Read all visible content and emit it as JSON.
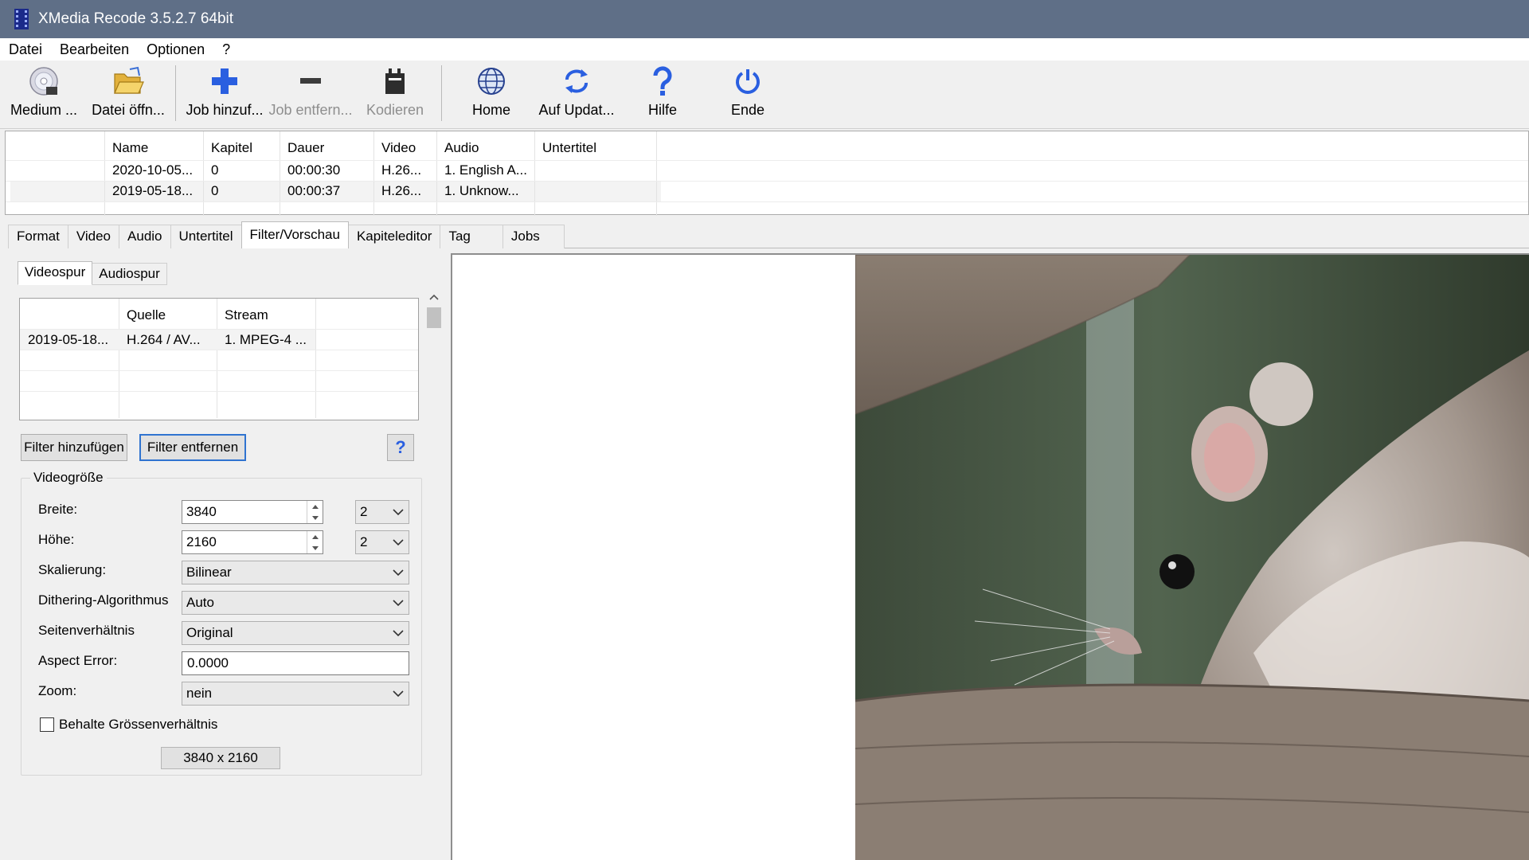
{
  "window": {
    "title": "XMedia Recode 3.5.2.7 64bit"
  },
  "menu": [
    "Datei",
    "Bearbeiten",
    "Optionen",
    "?"
  ],
  "toolbar": {
    "medium": "Medium ...",
    "open_file": "Datei öffn...",
    "add_job": "Job hinzuf...",
    "remove_job": "Job entfern...",
    "encode": "Kodieren",
    "home": "Home",
    "update": "Auf Updat...",
    "help": "Hilfe",
    "exit": "Ende"
  },
  "jobs": {
    "columns": [
      "Name",
      "Kapitel",
      "Dauer",
      "Video",
      "Audio",
      "Untertitel"
    ],
    "rows": [
      [
        "2020-10-05...",
        "0",
        "00:00:30",
        "H.26...",
        "1. English A...",
        ""
      ],
      [
        "2019-05-18...",
        "0",
        "00:00:37",
        "H.26...",
        "1. Unknow...",
        ""
      ]
    ]
  },
  "tabs": [
    "Format",
    "Video",
    "Audio",
    "Untertitel",
    "Filter/Vorschau",
    "Kapiteleditor",
    "Tag",
    "Jobs"
  ],
  "subtabs": [
    "Videospur",
    "Audiospur"
  ],
  "streams": {
    "columns": [
      "",
      "Quelle",
      "Stream"
    ],
    "rows": [
      [
        "2019-05-18...",
        "H.264 / AV...",
        "1. MPEG-4 ..."
      ]
    ]
  },
  "filters": {
    "add": "Filter hinzufügen",
    "remove": "Filter entfernen",
    "help": "?"
  },
  "videosize": {
    "title": "Videogröße",
    "width_label": "Breite:",
    "width_value": "3840",
    "width_div": "2",
    "height_label": "Höhe:",
    "height_value": "2160",
    "height_div": "2",
    "scaling_label": "Skalierung:",
    "scaling_value": "Bilinear",
    "dither_label": "Dithering-Algorithmus",
    "dither_value": "Auto",
    "aspect_label": "Seitenverhältnis",
    "aspect_value": "Original",
    "aspect_error_label": "Aspect Error:",
    "aspect_error_value": "0.0000",
    "zoom_label": "Zoom:",
    "zoom_value": "nein",
    "keep_ratio_label": "Behalte Grössenverhältnis",
    "keep_ratio_checked": false,
    "size_display": "3840 x 2160"
  },
  "colors": {
    "titlebar": "#5f6f87",
    "accent": "#2f73d0"
  }
}
